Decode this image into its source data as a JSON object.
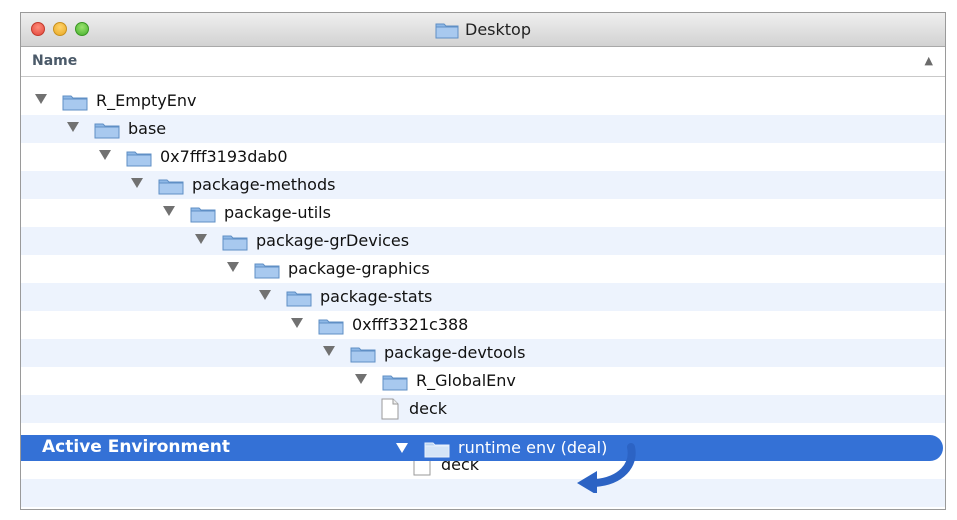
{
  "window": {
    "title": "Desktop"
  },
  "column_header": {
    "name": "Name",
    "sort_indicator": "▲"
  },
  "rows": [
    {
      "label": "R_EmptyEnv",
      "type": "folder",
      "expanded": true,
      "depth": 0
    },
    {
      "label": "base",
      "type": "folder",
      "expanded": true,
      "depth": 1
    },
    {
      "label": "0x7fff3193dab0",
      "type": "folder",
      "expanded": true,
      "depth": 2
    },
    {
      "label": "package-methods",
      "type": "folder",
      "expanded": true,
      "depth": 3
    },
    {
      "label": "package-utils",
      "type": "folder",
      "expanded": true,
      "depth": 4
    },
    {
      "label": "package-grDevices",
      "type": "folder",
      "expanded": true,
      "depth": 5
    },
    {
      "label": "package-graphics",
      "type": "folder",
      "expanded": true,
      "depth": 6
    },
    {
      "label": "package-stats",
      "type": "folder",
      "expanded": true,
      "depth": 7
    },
    {
      "label": "0xfff3321c388",
      "type": "folder",
      "expanded": true,
      "depth": 8
    },
    {
      "label": "package-devtools",
      "type": "folder",
      "expanded": true,
      "depth": 9
    },
    {
      "label": "R_GlobalEnv",
      "type": "folder",
      "expanded": true,
      "depth": 10
    },
    {
      "label": "deck",
      "type": "file",
      "depth": 11
    }
  ],
  "selected_row": {
    "annotation": "Active Environment",
    "label": "runtime env (deal)"
  },
  "after_rows": [
    {
      "label": "deck",
      "type": "file",
      "depth": 12
    }
  ],
  "colors": {
    "selection": "#3471d6",
    "alt_row": "#edf3fd",
    "folder": "#8fb8e6"
  }
}
